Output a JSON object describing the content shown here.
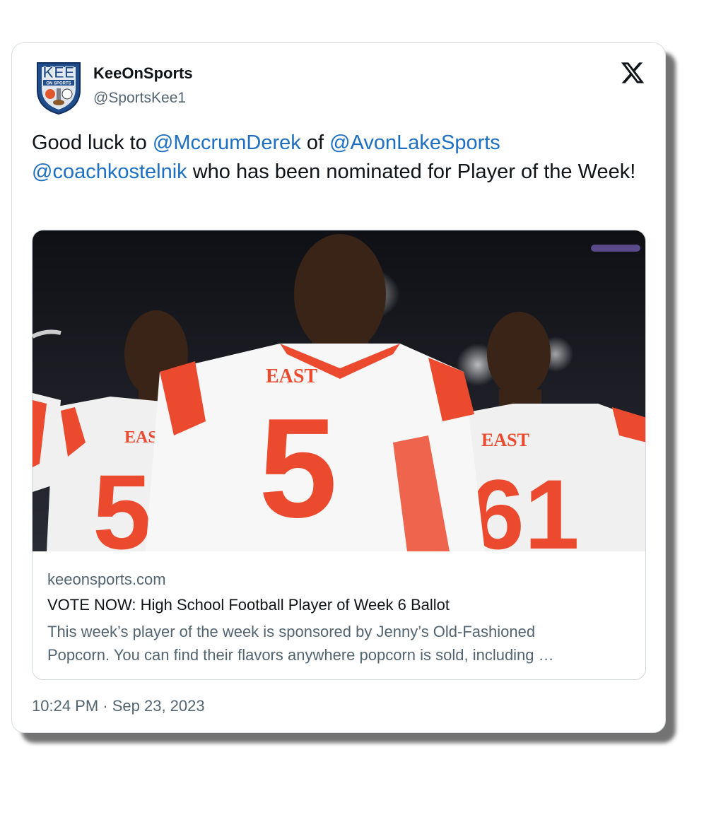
{
  "author": {
    "display_name": "KeeOnSports",
    "handle": "@SportsKee1",
    "avatar_text": "KEE",
    "avatar_subtext": "ON SPORTS"
  },
  "tweet": {
    "text_1": "Good luck to ",
    "mention_1": "@MccrumDerek",
    "text_2": " of ",
    "mention_2": "@AvonLakeSports",
    "mention_3": "@coachkostelnik",
    "text_3": "  who has been nominated for Player of the Week!"
  },
  "link_card": {
    "domain": "keeonsports.com",
    "title": "VOTE NOW: High School Football Player of Week 6 Ballot",
    "description_line1": "This week’s player of the week is sponsored by Jenny’s Old-Fashioned",
    "description_line2": "Popcorn. You can find their flavors anywhere popcorn is sold, including …",
    "image": {
      "jersey_text": "EAST",
      "numbers": [
        "5",
        "5",
        "61"
      ],
      "colors": {
        "jersey": "#f5f5f5",
        "accent": "#ec4a2e",
        "sky": "#15161d"
      }
    }
  },
  "timestamp": "10:24 PM · Sep 23, 2023",
  "icons": {
    "platform_logo": "x-logo-icon"
  },
  "colors": {
    "link": "#1d6fc2",
    "text": "#0f1419",
    "secondary": "#536471",
    "border": "#cfd9de"
  }
}
